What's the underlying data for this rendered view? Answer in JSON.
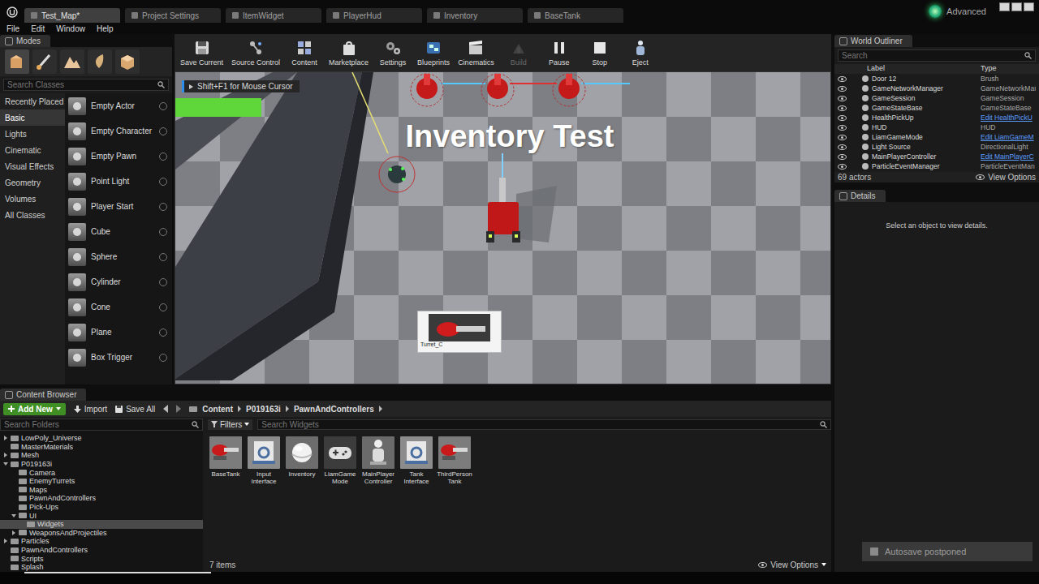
{
  "tabs": [
    {
      "label": "Test_Map*",
      "selected": true
    },
    {
      "label": "Project Settings",
      "selected": false
    },
    {
      "label": "ItemWidget",
      "selected": false
    },
    {
      "label": "PlayerHud",
      "selected": false
    },
    {
      "label": "Inventory",
      "selected": false
    },
    {
      "label": "BaseTank",
      "selected": false
    }
  ],
  "advanced": "Advanced",
  "menu": [
    "File",
    "Edit",
    "Window",
    "Help"
  ],
  "modes": {
    "title": "Modes",
    "search": "Search Classes",
    "categories": [
      {
        "label": "Recently Placed",
        "selected": false
      },
      {
        "label": "Basic",
        "selected": true
      },
      {
        "label": "Lights",
        "selected": false
      },
      {
        "label": "Cinematic",
        "selected": false
      },
      {
        "label": "Visual Effects",
        "selected": false
      },
      {
        "label": "Geometry",
        "selected": false
      },
      {
        "label": "Volumes",
        "selected": false
      },
      {
        "label": "All Classes",
        "selected": false
      }
    ],
    "items": [
      "Empty Actor",
      "Empty Character",
      "Empty Pawn",
      "Point Light",
      "Player Start",
      "Cube",
      "Sphere",
      "Cylinder",
      "Cone",
      "Plane",
      "Box Trigger"
    ]
  },
  "toolbar": [
    {
      "label": "Save Current",
      "disabled": false
    },
    {
      "label": "Source Control",
      "disabled": false
    },
    {
      "label": "Content",
      "disabled": false
    },
    {
      "label": "Marketplace",
      "disabled": false
    },
    {
      "label": "Settings",
      "disabled": false
    },
    {
      "label": "Blueprints",
      "disabled": false
    },
    {
      "label": "Cinematics",
      "disabled": false
    },
    {
      "label": "Build",
      "disabled": true
    },
    {
      "label": "Pause",
      "disabled": false
    },
    {
      "label": "Stop",
      "disabled": false
    },
    {
      "label": "Eject",
      "disabled": false
    }
  ],
  "viewport": {
    "hint": "Shift+F1 for Mouse Cursor",
    "health_level": 1,
    "scene_text": "Inventory Test",
    "item_widget": "Turret_C"
  },
  "outliner": {
    "title": "World Outliner",
    "search": "Search",
    "columns": [
      "Label",
      "Type"
    ],
    "rows": [
      {
        "label": "Door 12",
        "type": "Brush",
        "link": false
      },
      {
        "label": "GameNetworkManager",
        "type": "GameNetworkMar",
        "link": false
      },
      {
        "label": "GameSession",
        "type": "GameSession",
        "link": false
      },
      {
        "label": "GameStateBase",
        "type": "GameStateBase",
        "link": false
      },
      {
        "label": "HealthPickUp",
        "type": "Edit HealthPickU",
        "link": true
      },
      {
        "label": "HUD",
        "type": "HUD",
        "link": false
      },
      {
        "label": "LiamGameMode",
        "type": "Edit LiamGameM",
        "link": true
      },
      {
        "label": "Light Source",
        "type": "DirectionalLight",
        "link": false
      },
      {
        "label": "MainPlayerController",
        "type": "Edit MainPlayerC",
        "link": true
      },
      {
        "label": "ParticleEventManager",
        "type": "ParticleEventMan",
        "link": false
      }
    ],
    "count": "69 actors",
    "view_options": "View Options"
  },
  "details": {
    "title": "Details",
    "empty": "Select an object to view details."
  },
  "content_browser": {
    "title": "Content Browser",
    "add_new": "Add New",
    "import": "Import",
    "save_all": "Save All",
    "path": [
      "Content",
      "P019163i",
      "PawnAndControllers"
    ],
    "folder_search": "Search Folders",
    "tree": [
      {
        "label": "LowPoly_Universe",
        "depth": 0,
        "kind": "collapsed",
        "selected": false
      },
      {
        "label": "MasterMaterials",
        "depth": 0,
        "kind": "leaf",
        "selected": false
      },
      {
        "label": "Mesh",
        "depth": 0,
        "kind": "collapsed",
        "selected": false
      },
      {
        "label": "P019163i",
        "depth": 0,
        "kind": "expanded",
        "selected": false
      },
      {
        "label": "Camera",
        "depth": 1,
        "kind": "leaf",
        "selected": false
      },
      {
        "label": "EnemyTurrets",
        "depth": 1,
        "kind": "leaf",
        "selected": false
      },
      {
        "label": "Maps",
        "depth": 1,
        "kind": "leaf",
        "selected": false
      },
      {
        "label": "PawnAndControllers",
        "depth": 1,
        "kind": "leaf",
        "selected": false
      },
      {
        "label": "Pick-Ups",
        "depth": 1,
        "kind": "leaf",
        "selected": false
      },
      {
        "label": "UI",
        "depth": 1,
        "kind": "expanded",
        "selected": false
      },
      {
        "label": "Widgets",
        "depth": 2,
        "kind": "leaf",
        "selected": true
      },
      {
        "label": "WeaponsAndProjectiles",
        "depth": 1,
        "kind": "collapsed",
        "selected": false
      },
      {
        "label": "Particles",
        "depth": 0,
        "kind": "collapsed",
        "selected": false
      },
      {
        "label": "PawnAndControllers",
        "depth": 0,
        "kind": "leaf",
        "selected": false
      },
      {
        "label": "Scripts",
        "depth": 0,
        "kind": "leaf",
        "selected": false
      },
      {
        "label": "Splash",
        "depth": 0,
        "kind": "leaf",
        "selected": false
      }
    ],
    "filters": "Filters",
    "asset_search": "Search Widgets",
    "assets": [
      {
        "label": "BaseTank",
        "kind": "tank"
      },
      {
        "label": "Input Interface",
        "kind": "interface"
      },
      {
        "label": "Inventory",
        "kind": "object"
      },
      {
        "label": "LiamGame Mode",
        "kind": "gamemode"
      },
      {
        "label": "MainPlayer Controller",
        "kind": "controller"
      },
      {
        "label": "Tank Interface",
        "kind": "interface"
      },
      {
        "label": "ThirdPerson Tank",
        "kind": "tank"
      }
    ],
    "count": "7 items",
    "view_options": "View Options"
  },
  "toast": "Autosave postponed"
}
